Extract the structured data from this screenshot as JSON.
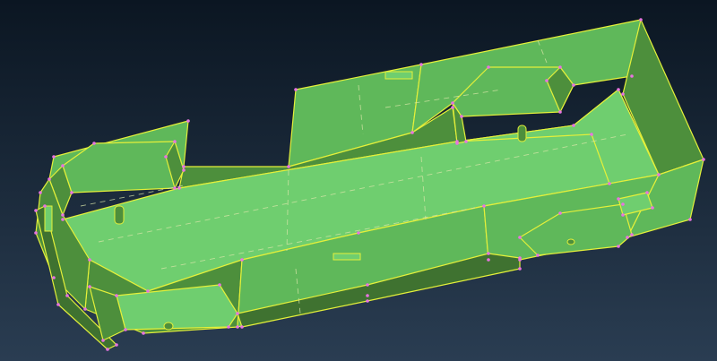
{
  "viewport": {
    "background_top": "#0b1622",
    "background_bottom": "#2a3d52"
  },
  "model": {
    "face_light": "#6fce6f",
    "face_mid": "#5fb85a",
    "face_dark": "#4d8f3c",
    "face_shadow": "#3f7230",
    "edge_color": "#e4f03a",
    "dashed_edge_color": "#d8e6a8",
    "vertex_marker_color": "#e874e0"
  }
}
